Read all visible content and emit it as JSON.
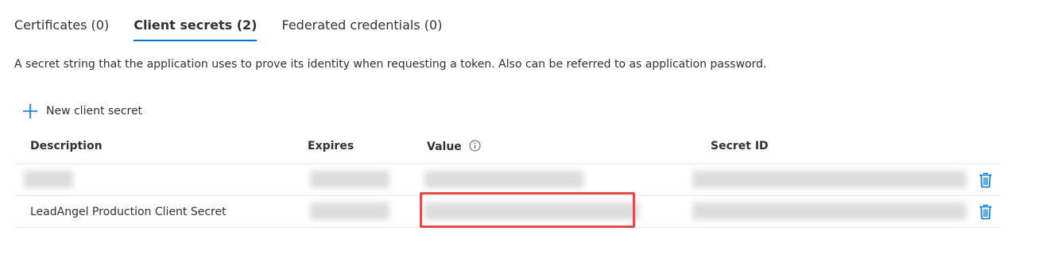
{
  "tabs": [
    {
      "label": "Certificates (0)",
      "active": false
    },
    {
      "label": "Client secrets (2)",
      "active": true
    },
    {
      "label": "Federated credentials (0)",
      "active": false
    }
  ],
  "description": "A secret string that the application uses to prove its identity when requesting a token. Also can be referred to as application password.",
  "new_secret_label": "New client secret",
  "table": {
    "headers": {
      "description": "Description",
      "expires": "Expires",
      "value": "Value",
      "secret_id": "Secret ID"
    },
    "rows": [
      {
        "description": ""
      },
      {
        "description": "LeadAngel Production Client Secret"
      }
    ]
  },
  "colors": {
    "accent": "#0078d4",
    "highlight": "#e04c4c"
  },
  "icons": {
    "add": "plus-icon",
    "info": "info-icon",
    "delete": "trash-icon"
  }
}
